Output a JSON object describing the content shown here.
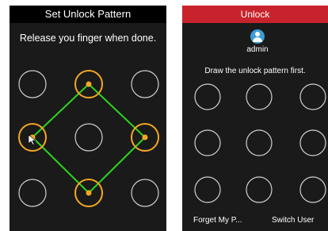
{
  "set_dialog": {
    "title": "Set Unlock Pattern",
    "instruction": "Release you finger when done.",
    "selected_dots": [
      1,
      3,
      5,
      7
    ],
    "pattern_path": [
      1,
      5,
      7,
      3,
      1
    ]
  },
  "unlock_dialog": {
    "title": "Unlock",
    "username": "admin",
    "avatar_icon": "user-icon",
    "instruction": "Draw the unlock pattern first.",
    "forget_label": "Forget My P...",
    "switch_label": "Switch User"
  },
  "colors": {
    "unlock_header": "#c8232c",
    "selected_ring": "#f5a623",
    "path_line": "#2bd61f",
    "panel_bg": "#1a1a1a"
  }
}
